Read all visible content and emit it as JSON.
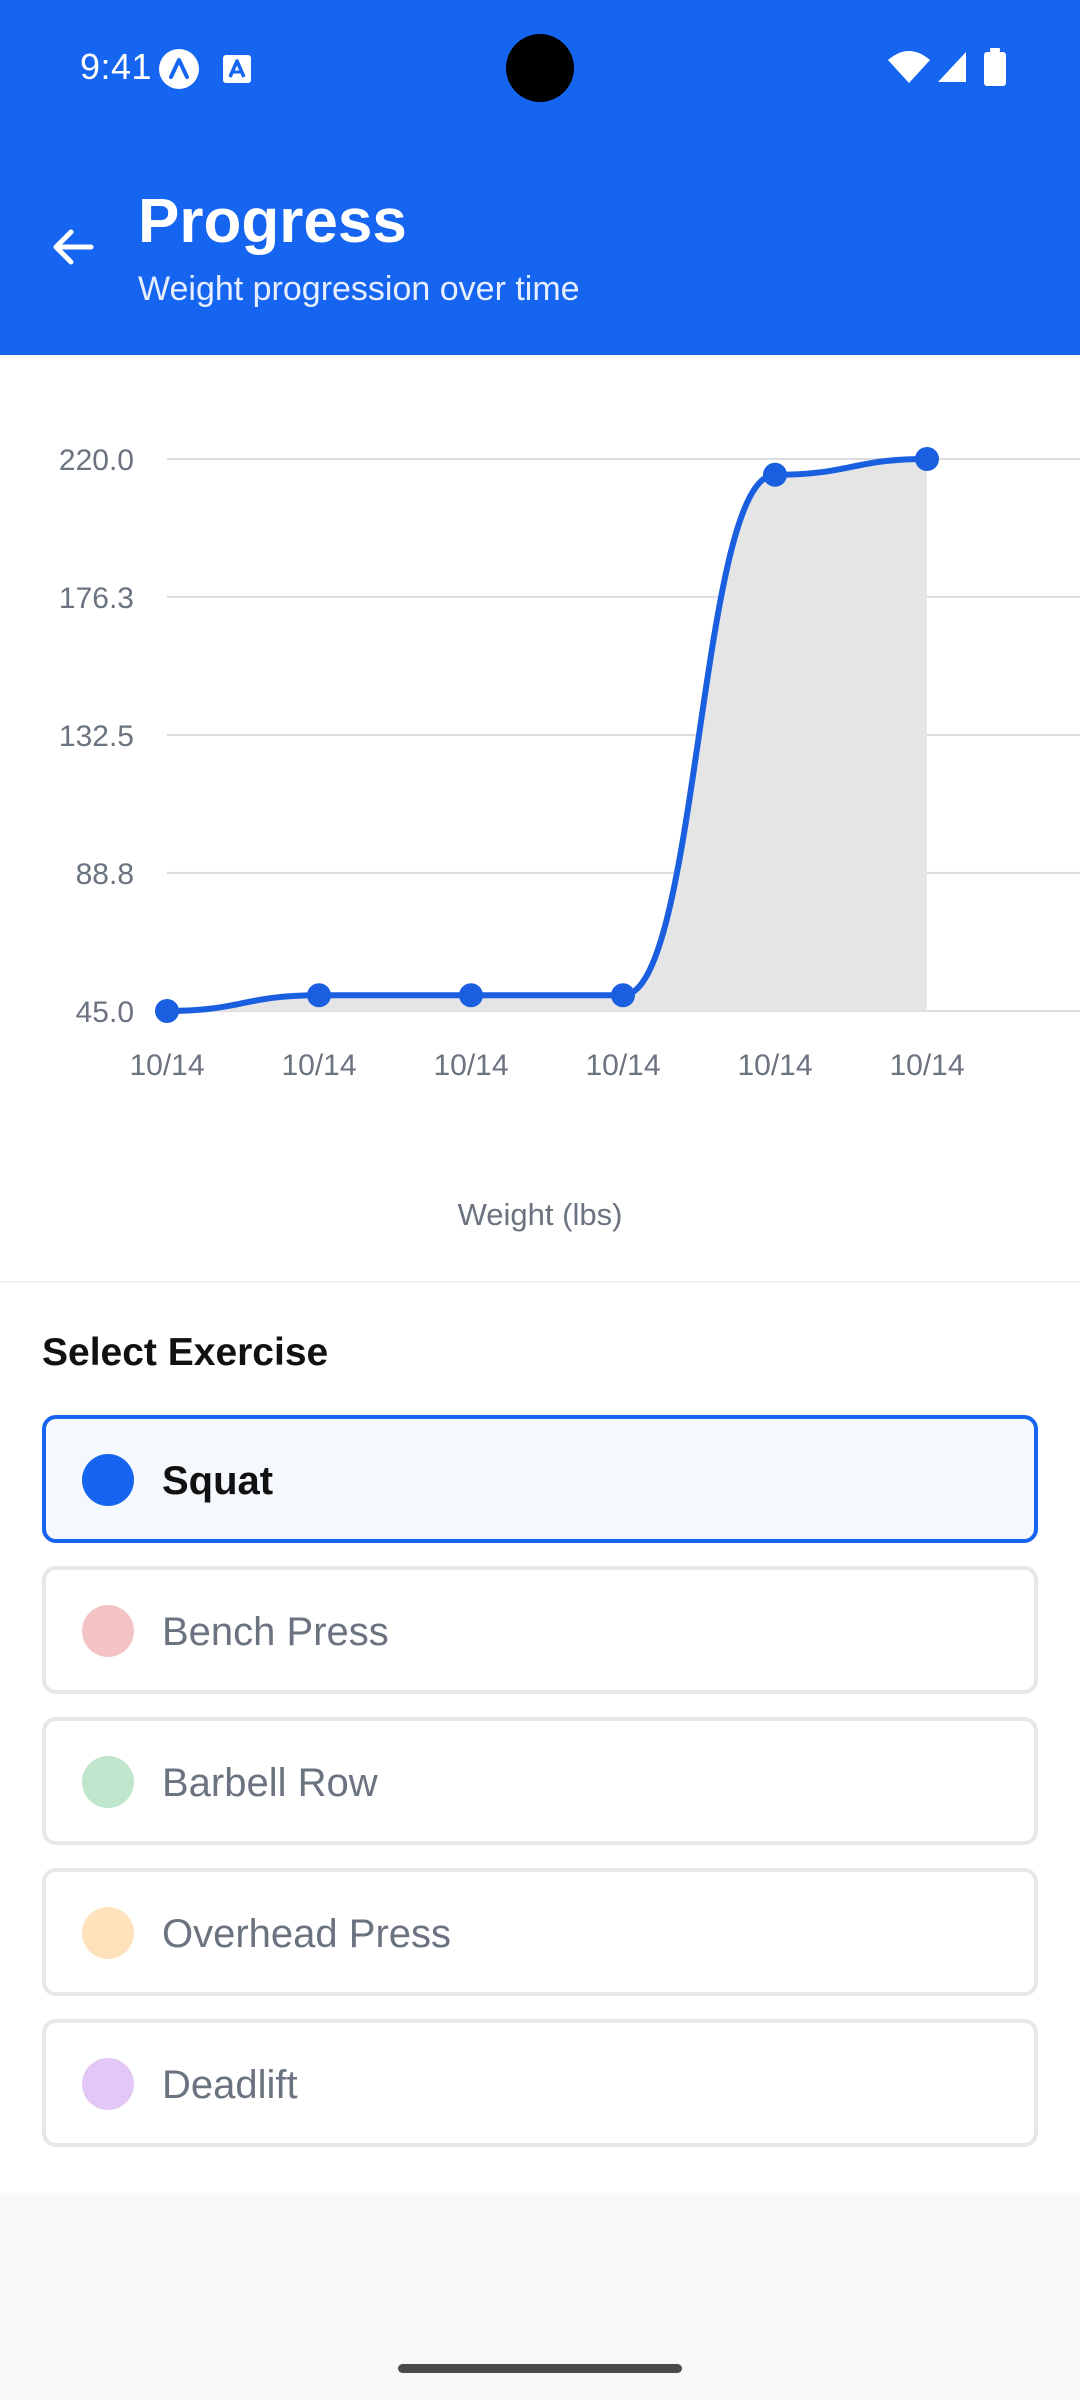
{
  "status_bar": {
    "time": "9:41",
    "icons": [
      "app-a-icon",
      "text-a-icon",
      "wifi-icon",
      "signal-icon",
      "battery-icon"
    ],
    "background": "#1565f0"
  },
  "header": {
    "title": "Progress",
    "subtitle": "Weight progression over time",
    "back_icon": "arrow-left-icon",
    "background": "#1565f0"
  },
  "chart_data": {
    "type": "line",
    "title": "",
    "xlabel": "",
    "ylabel": "",
    "caption": "Weight (lbs)",
    "x": [
      "10/14",
      "10/14",
      "10/14",
      "10/14",
      "10/14",
      "10/14"
    ],
    "y_ticks": [
      "220.0",
      "176.3",
      "132.5",
      "88.8",
      "45.0"
    ],
    "ylim": [
      45.0,
      220.0
    ],
    "series": [
      {
        "values": [
          45,
          50,
          50,
          50,
          215,
          220
        ],
        "color": "#1a5fe0"
      }
    ],
    "grid": true,
    "legend": "none",
    "shaded_area": true
  },
  "selector": {
    "title": "Select Exercise",
    "items": [
      {
        "label": "Squat",
        "color": "#1565f0",
        "selected": true
      },
      {
        "label": "Bench Press",
        "color": "#f3c3c3",
        "selected": false
      },
      {
        "label": "Barbell Row",
        "color": "#bfe6cd",
        "selected": false
      },
      {
        "label": "Overhead Press",
        "color": "#fde2bc",
        "selected": false
      },
      {
        "label": "Deadlift",
        "color": "#e2c7f7",
        "selected": false
      }
    ]
  }
}
